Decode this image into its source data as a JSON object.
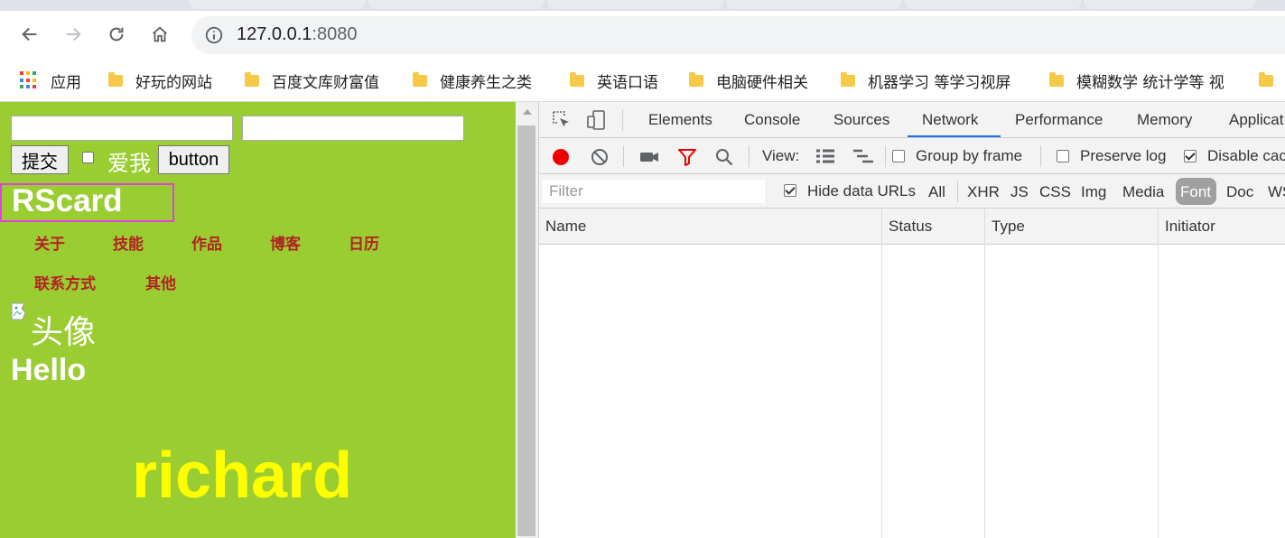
{
  "browser": {
    "url_host": "127.0.0.1",
    "url_port": ":8080",
    "nav": [
      "back-icon",
      "forward-icon",
      "reload-icon",
      "home-icon"
    ],
    "bookmarks": [
      "应用",
      "好玩的网站",
      "百度文库财富值",
      "健康养生之类",
      "英语口语",
      "电脑硬件相关",
      "机器学习 等学习视屏",
      "模糊数学 统计学等 视"
    ]
  },
  "page": {
    "submit_label": "提交",
    "love_label": "爱我",
    "button_label": "button",
    "logo_text": "RScard",
    "nav_items": [
      "关于",
      "技能",
      "作品",
      "博客",
      "日历",
      "联系方式",
      "其他"
    ],
    "avatar_alt": "头像",
    "hello": "Hello",
    "name": "richard",
    "colors": {
      "background": "#9acd32",
      "nav_text": "#b22222",
      "name_text": "#ffff00",
      "logo_border": "#e040e0"
    }
  },
  "devtools": {
    "tabs": [
      "Elements",
      "Console",
      "Sources",
      "Network",
      "Performance",
      "Memory",
      "Applicat"
    ],
    "active_tab": "Network",
    "toolbar": {
      "view_label": "View:",
      "group_by_frame": "Group by frame",
      "preserve_log": "Preserve log",
      "disable_cache": "Disable cac"
    },
    "filter_placeholder": "Filter",
    "hide_data_urls": "Hide data URLs",
    "filter_types": [
      "All",
      "XHR",
      "JS",
      "CSS",
      "Img",
      "Media",
      "Font",
      "Doc",
      "WS"
    ],
    "active_filter": "Font",
    "columns": [
      "Name",
      "Status",
      "Type",
      "Initiator"
    ],
    "accent_color": "#1a73e8"
  }
}
